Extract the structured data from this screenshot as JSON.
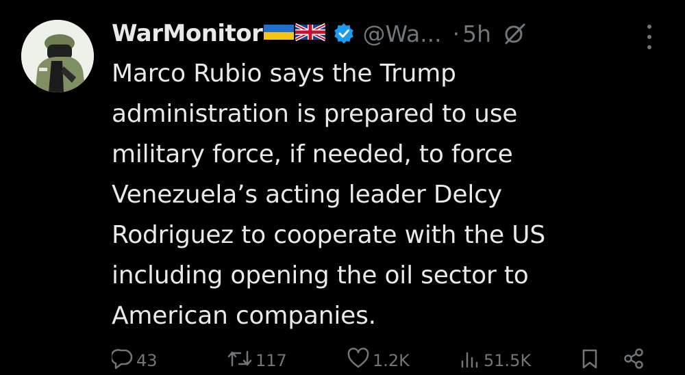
{
  "author": {
    "name": "WarMonitor",
    "handle": "@Wa...",
    "time_separator": "·",
    "time": "5h"
  },
  "tweet": {
    "text": "Marco Rubio says the Trump\nadministration is prepared to use\nmilitary force, if needed, to force\nVenezuela’s acting leader Delcy\nRodriguez to cooperate with the US\nincluding opening the oil sector to\nAmerican companies."
  },
  "actions": {
    "replies": "43",
    "reposts": "117",
    "likes": "1.2K",
    "views": "51.5K"
  },
  "colors": {
    "background": "#000000",
    "text": "#e7e9ea",
    "muted": "#71767b",
    "verified": "#1d9bf0"
  },
  "icons": [
    "avatar",
    "ukraine-flag-icon",
    "uk-flag-icon",
    "verified-badge-icon",
    "grok-icon",
    "more-icon",
    "reply-icon",
    "repost-icon",
    "like-icon",
    "views-icon",
    "bookmark-icon",
    "share-icon"
  ]
}
